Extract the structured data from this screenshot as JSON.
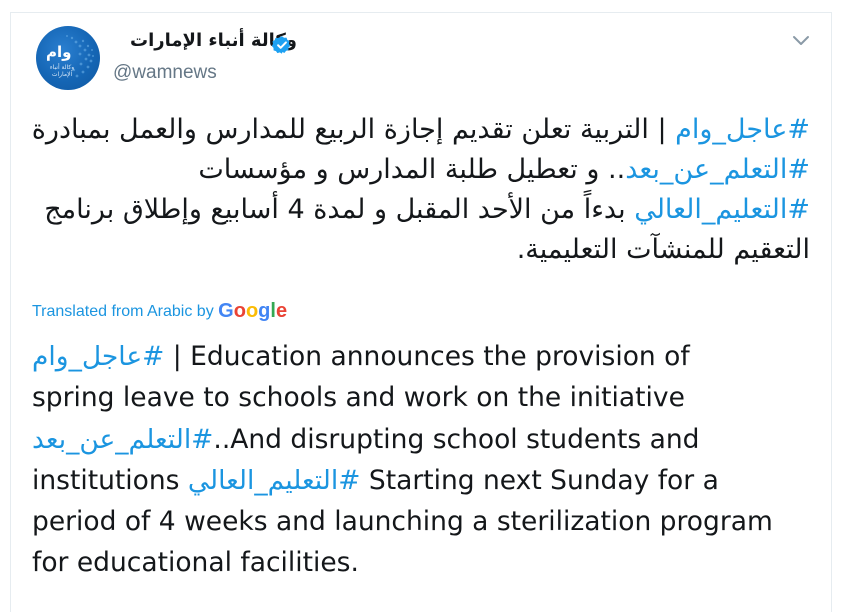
{
  "tweet": {
    "author_name": "وكالة أنباء الإمارات",
    "handle": "@wamnews",
    "verified": true,
    "avatar_icon": "globe-logo",
    "avatar_logo_text": "وام",
    "avatar_logo_subtext": "وكالة أنباء الإمارات"
  },
  "arabic_body": {
    "hashtag_breaking": "#عاجل_وام",
    "segment_1": " | التربية تعلن تقديم إجازة الربيع للمدارس والعمل بمبادرة ",
    "hashtag_remote_learning": "#التعلم_عن_بعد",
    "segment_2": ".. و تعطيل طلبة المدارس و مؤسسات ",
    "hashtag_higher_education": "#التعليم_العالي",
    "segment_3": " بدءاً من الأحد المقبل و لمدة 4 أسابيع وإطلاق برنامج التعقيم للمنشآت التعليمية."
  },
  "translation": {
    "label": "Translated from Arabic by",
    "provider": "Google",
    "lines": {
      "l1_hashtag": "#عاجل_وام",
      "l1_text": " | Education announces the provision of",
      "l2_text": "spring leave to schools and work on the initiative",
      "l3_hashtag": "#التعلم_عن_بعد",
      "l3_text": "..And disrupting school students and",
      "l4_text_a": "institutions ",
      "l4_hashtag": "#التعليم_العالي",
      "l4_text_b": " Starting next Sunday for a",
      "l5_text": "period of 4 weeks and launching a sterilization program",
      "l6_text": "for educational facilities."
    }
  },
  "colors": {
    "link": "#1b95e0",
    "text": "#14171a",
    "muted": "#657786",
    "verified": "#1da1f2",
    "google_blue": "#4285f4",
    "google_red": "#ea4335",
    "google_yellow": "#fbbc05",
    "google_green": "#34a853"
  }
}
